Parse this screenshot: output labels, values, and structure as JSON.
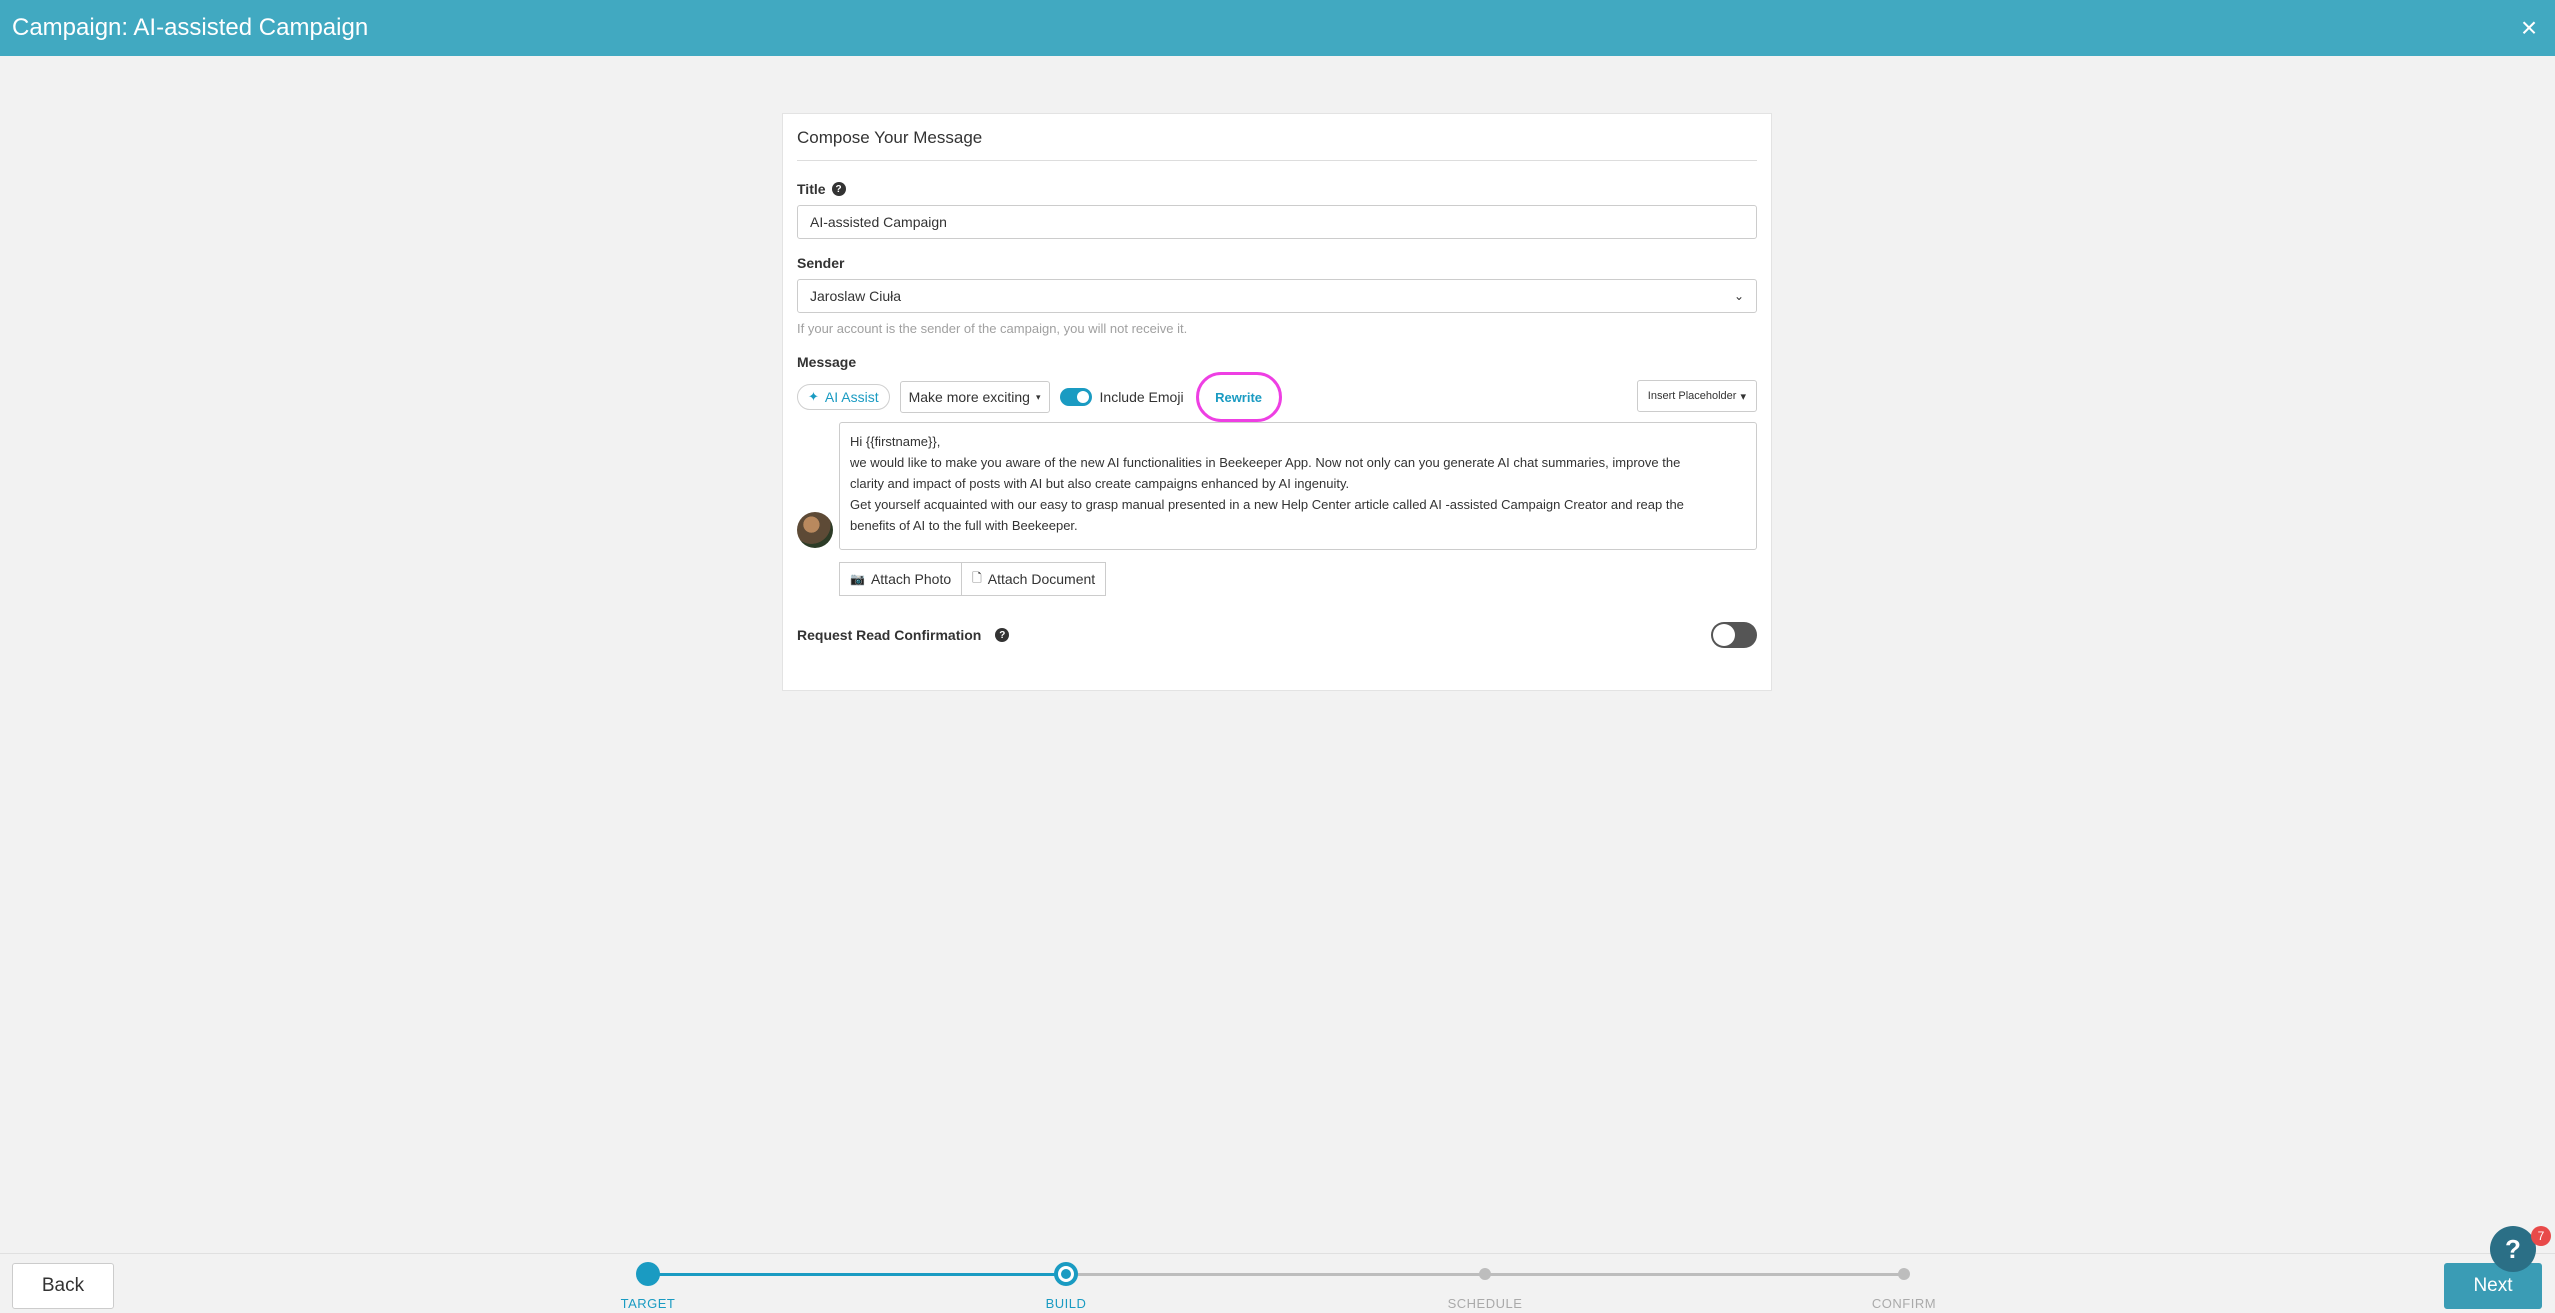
{
  "header": {
    "title": "Campaign: AI-assisted Campaign",
    "close_icon": "×"
  },
  "compose": {
    "heading": "Compose Your Message",
    "title_label": "Title",
    "title_help_icon": "?",
    "title_value": "AI-assisted Campaign",
    "sender_label": "Sender",
    "sender_value": "Jaroslaw Ciuła",
    "sender_caret": "⌄",
    "sender_hint": "If your account is the sender of the campaign, you will not receive it.",
    "message_label": "Message",
    "ai_assist_icon": "✦",
    "ai_assist_label": "AI Assist",
    "mode_label": "Make more exciting",
    "mode_caret": "▾",
    "include_emoji_label": "Include Emoji",
    "rewrite_label": "Rewrite",
    "insert_placeholder_label": "Insert Placeholder",
    "insert_placeholder_caret": "▾",
    "message_lines": [
      "Hi {{firstname}},",
      "we would like to make you aware of the new AI functionalities in Beekeeper App. Now not only can you generate AI chat summaries, improve the",
      "clarity and impact of posts with AI but also create campaigns enhanced by AI ingenuity.",
      "Get yourself acquainted with our easy to grasp manual presented in a new Help Center article called AI -assisted Campaign Creator and reap the",
      "benefits of AI to the full with Beekeeper."
    ],
    "attach_photo_icon": "📷",
    "attach_photo_label": "Attach Photo",
    "attach_document_icon": "🗋",
    "attach_document_label": "Attach Document",
    "read_confirmation_label": "Request Read Confirmation",
    "read_help_icon": "?"
  },
  "footer": {
    "back_label": "Back",
    "next_label": "Next",
    "steps": [
      "TARGET",
      "BUILD",
      "SCHEDULE",
      "CONFIRM"
    ],
    "current_step_index": 1
  },
  "help_widget": {
    "icon": "?",
    "badge": "7"
  },
  "colors": {
    "header": "#41a9c1",
    "accent": "#1a9bc2",
    "highlight": "#ee3fe3",
    "next_button": "#3a9cb5",
    "step_inactive": "#bdbdbd"
  }
}
